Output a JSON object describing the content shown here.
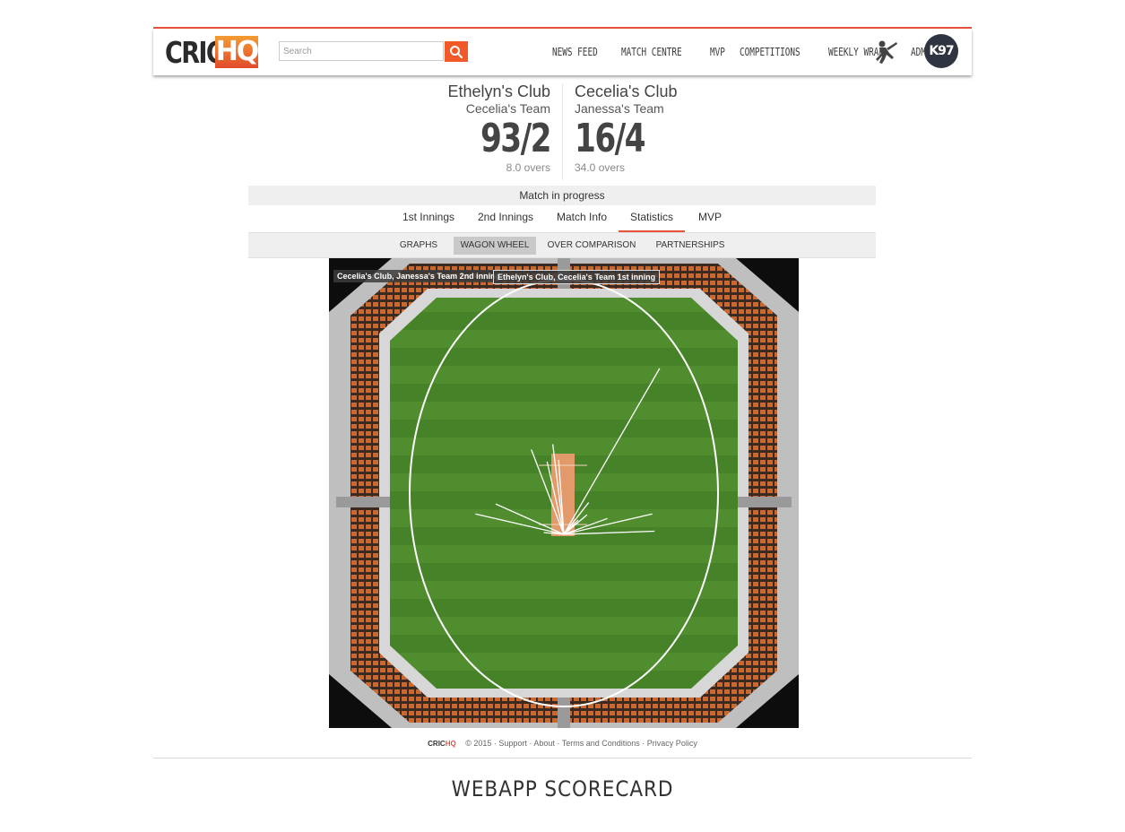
{
  "header": {
    "logo_left": "CRIC",
    "logo_right": "HQ",
    "search_placeholder": "Search",
    "nav": [
      "NEWS FEED",
      "MATCH CENTRE",
      "MVP",
      "COMPETITIONS",
      "WEEKLY WRAP",
      "ADMIN"
    ],
    "avatar_text": "K97"
  },
  "match": {
    "team1": {
      "club": "Ethelyn's Club",
      "team": "Cecelia's Team",
      "score": "93/2",
      "overs": "8.0 overs"
    },
    "team2": {
      "club": "Cecelia's Club",
      "team": "Janessa's Team",
      "score": "16/4",
      "overs": "34.0 overs"
    },
    "status": "Match in progress"
  },
  "tabs": [
    "1st Innings",
    "2nd Innings",
    "Match Info",
    "Statistics",
    "MVP"
  ],
  "active_tab": "Statistics",
  "subtabs": [
    "GRAPHS",
    "WAGON WHEEL",
    "OVER COMPARISON",
    "PARTNERSHIPS"
  ],
  "active_subtab": "WAGON WHEEL",
  "wagon_wheel": {
    "legend": [
      "Cecelia's Club, Janessa's Team 2nd inning",
      "Ethelyn's Club, Cecelia's Team 1st inning"
    ],
    "colors": {
      "grass": "#4d8a2c",
      "pitch": "#e39a6b",
      "shot_line": "#ffffff",
      "stand_orange": "#d9682a"
    },
    "shots": [
      {
        "angle_deg": 30,
        "length": 0.95
      },
      {
        "angle_deg": -21,
        "length": 0.45
      },
      {
        "angle_deg": -7,
        "length": 0.45
      },
      {
        "angle_deg": -13,
        "length": 0.37
      },
      {
        "angle_deg": -4,
        "length": 0.37
      },
      {
        "angle_deg": 38,
        "length": 0.2
      },
      {
        "angle_deg": 50,
        "length": 0.15
      },
      {
        "angle_deg": 70,
        "length": 0.23
      },
      {
        "angle_deg": 77,
        "length": 0.45
      },
      {
        "angle_deg": 88,
        "length": 0.45
      },
      {
        "angle_deg": -66,
        "length": 0.37
      },
      {
        "angle_deg": -77,
        "length": 0.45
      },
      {
        "angle_deg": -85,
        "length": 0.1
      },
      {
        "angle_deg": 45,
        "length": 0.1
      }
    ]
  },
  "footer": {
    "logo_left": "CRIC",
    "logo_right": "HQ",
    "copyright": "© 2015 · Support · About · Terms and Conditions · Privacy Policy"
  },
  "caption": "WEBAPP SCORECARD"
}
